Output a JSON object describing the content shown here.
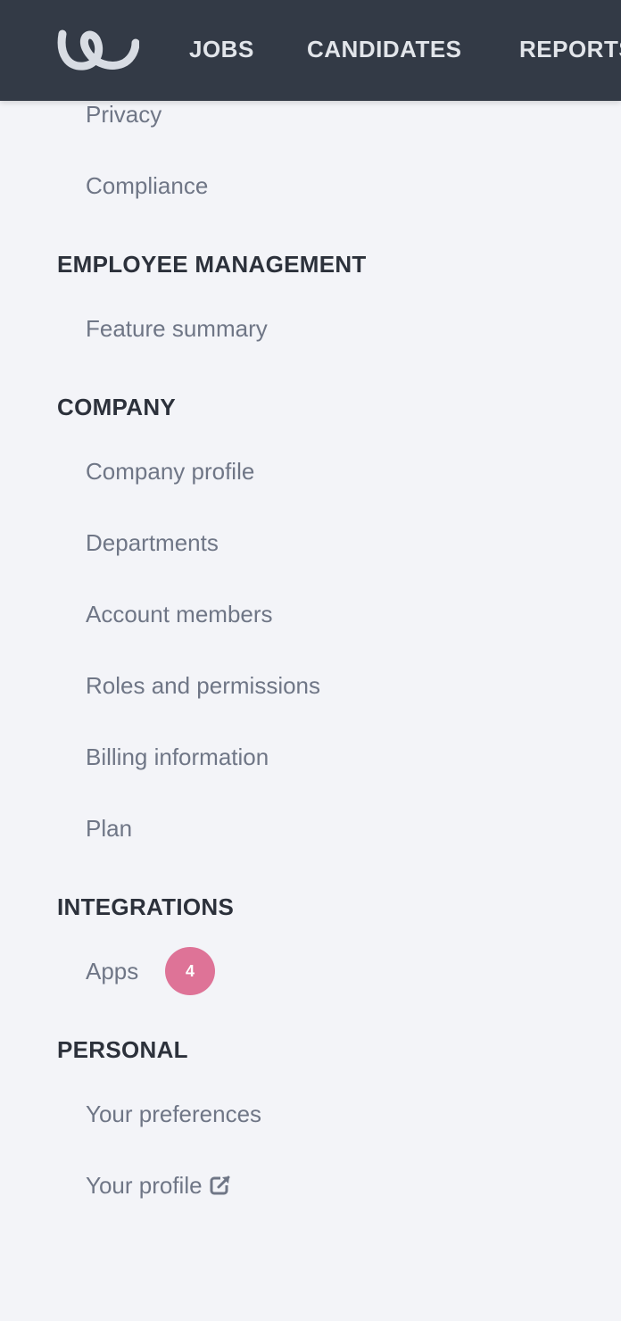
{
  "nav": {
    "links": [
      "JOBS",
      "CANDIDATES",
      "REPORTS"
    ]
  },
  "sidebar": {
    "items_top": [
      {
        "label": "Privacy"
      },
      {
        "label": "Compliance"
      }
    ],
    "sections": [
      {
        "heading": "EMPLOYEE MANAGEMENT",
        "items": [
          {
            "label": "Feature summary"
          }
        ]
      },
      {
        "heading": "COMPANY",
        "items": [
          {
            "label": "Company profile"
          },
          {
            "label": "Departments"
          },
          {
            "label": "Account members"
          },
          {
            "label": "Roles and permissions"
          },
          {
            "label": "Billing information"
          },
          {
            "label": "Plan"
          }
        ]
      },
      {
        "heading": "INTEGRATIONS",
        "items": [
          {
            "label": "Apps",
            "badge": "4"
          }
        ]
      },
      {
        "heading": "PERSONAL",
        "items": [
          {
            "label": "Your preferences"
          },
          {
            "label": "Your profile",
            "icon": "external-link-icon"
          }
        ]
      }
    ]
  },
  "colors": {
    "topbar": "#333a46",
    "background": "#f3f4f8",
    "badge": "#de7397",
    "item_text": "#6f7686",
    "heading_text": "#2c313b"
  }
}
